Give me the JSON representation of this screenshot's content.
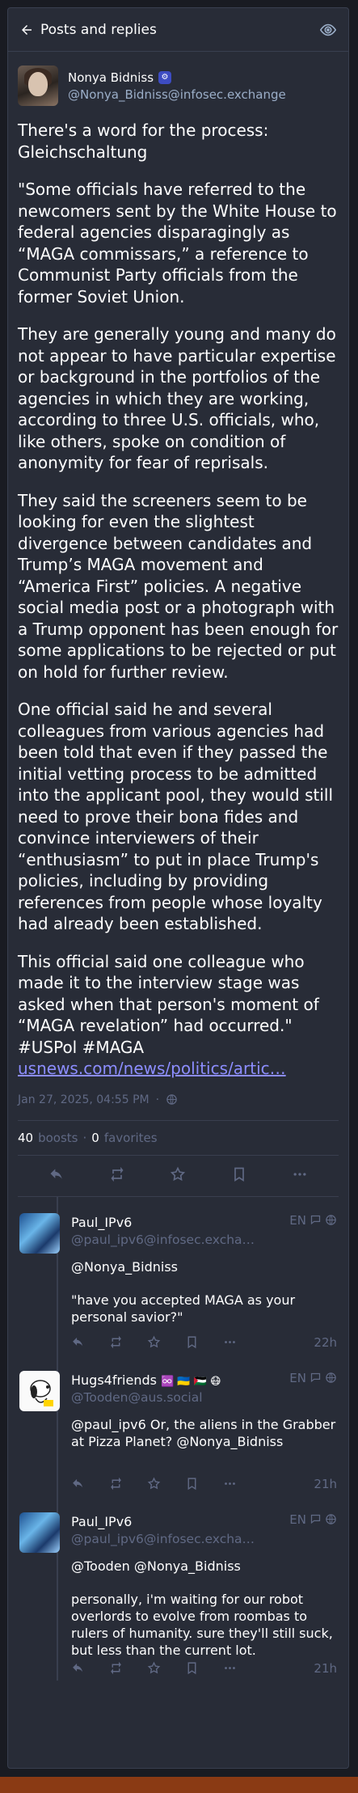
{
  "header": {
    "title": "Posts and replies"
  },
  "status": {
    "display_name": "Nonya Bidniss",
    "account": "@Nonya_Bidniss@infosec.exchange",
    "paragraphs": [
      "There's a word for the process: Gleichschaltung",
      "\"Some officials have referred to the newcomers sent by the White House to federal agencies disparagingly as “MAGA commissars,” a reference to Communist Party officials from the former Soviet Union.",
      "They are generally young and many do not appear to have particular expertise or background in the portfolios of the agencies in which they are working, according to three U.S. officials, who, like others, spoke on condition of anonymity for fear of reprisals.",
      "They said the screeners seem to be looking for even the slightest divergence between candidates and Trump’s MAGA movement and “America First” policies. A negative social media post or a photograph with a Trump opponent has been enough for some applications to be rejected or put on hold for further review.",
      "One official said he and several colleagues from various agencies had been told that even if they passed the initial vetting process to be admitted into the applicant pool, they would still need to prove their bona fides and convince interviewers of their “enthusiasm” to put in place Trump's policies, including by providing references from people whose loyalty had already been established."
    ],
    "last_paragraph": "This official said one colleague who made it to the interview stage was asked when that person's moment of “MAGA revelation” had occurred.\" #USPol #MAGA",
    "link": "usnews.com/news/politics/artic…",
    "timestamp": "Jan 27, 2025, 04:55 PM",
    "separator": "·",
    "boosts_count": "40",
    "boosts_label": "boosts",
    "favorites_count": "0",
    "favorites_label": "favorites"
  },
  "replies": [
    {
      "display_name": "Paul_IPv6",
      "account": "@paul_ipv6@infosec.excha…",
      "lang": "EN",
      "paragraphs": [
        "@Nonya_Bidniss",
        "\"have you accepted MAGA as your personal savior?\""
      ],
      "time": "22h",
      "avatar": "ipv6"
    },
    {
      "display_name": "Hugs4friends",
      "name_emojis": "♾️ 🇺🇦 🇵🇸 😷",
      "account": "@Tooden@aus.social",
      "lang": "EN",
      "paragraphs": [
        "@paul_ipv6 Or, the aliens in the Grabber at Pizza Planet? @Nonya_Bidniss"
      ],
      "time": "21h",
      "avatar": "snoopy"
    },
    {
      "display_name": "Paul_IPv6",
      "account": "@paul_ipv6@infosec.excha…",
      "lang": "EN",
      "paragraphs": [
        "@Tooden @Nonya_Bidniss",
        "personally, i'm waiting for our robot overlords to evolve from roombas to rulers of humanity. sure they'll still suck, but less than the current lot."
      ],
      "time": "21h",
      "avatar": "ipv6"
    }
  ],
  "colors": {
    "accent": "#8c8dff",
    "muted": "#606984",
    "panel": "#282c37",
    "background": "#191b22"
  },
  "icons": [
    "back-arrow-icon",
    "eye-icon",
    "bot-icon",
    "globe-icon",
    "reply-icon",
    "boost-icon",
    "star-icon",
    "bookmark-icon",
    "more-icon",
    "quote-icon"
  ]
}
